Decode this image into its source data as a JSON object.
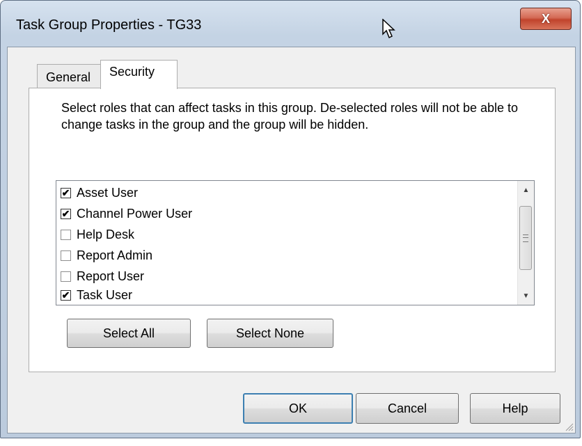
{
  "window": {
    "title": "Task Group Properties - TG33",
    "close_label": "X"
  },
  "tabs": [
    {
      "label": "General",
      "selected": false
    },
    {
      "label": "Security",
      "selected": true
    }
  ],
  "security": {
    "description": "Select roles that can affect tasks in this group. De-selected roles will not be able to change tasks in the group and the group will be hidden.",
    "roles": [
      {
        "label": "Asset User",
        "checked": true
      },
      {
        "label": "Channel Power User",
        "checked": true
      },
      {
        "label": "Help Desk",
        "checked": false
      },
      {
        "label": "Report Admin",
        "checked": false
      },
      {
        "label": "Report User",
        "checked": false
      },
      {
        "label": "Task User",
        "checked": true
      }
    ],
    "select_all_label": "Select All",
    "select_none_label": "Select None"
  },
  "footer": {
    "ok_label": "OK",
    "cancel_label": "Cancel",
    "help_label": "Help"
  },
  "icons": {
    "check": "check-mark",
    "scroll_up": "scroll-up-arrow",
    "scroll_down": "scroll-down-arrow"
  }
}
